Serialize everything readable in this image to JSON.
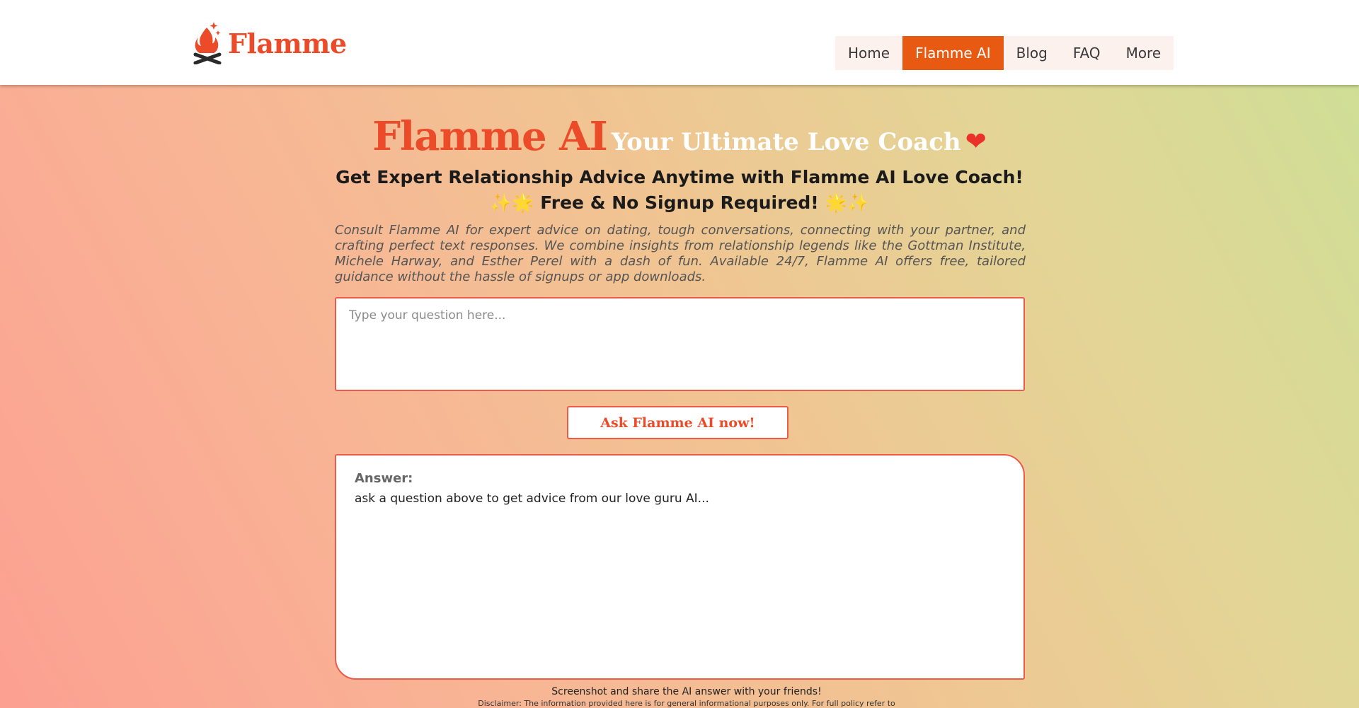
{
  "header": {
    "logo_text": "Flamme",
    "nav": [
      {
        "label": "Home",
        "active": false
      },
      {
        "label": "Flamme AI",
        "active": true
      },
      {
        "label": "Blog",
        "active": false
      },
      {
        "label": "FAQ",
        "active": false
      },
      {
        "label": "More",
        "active": false
      }
    ]
  },
  "hero": {
    "brand": "Flamme AI",
    "tagline": "Your Ultimate Love Coach",
    "heart_icon": "heart-on-fire-icon",
    "subtitle1": "Get Expert Relationship Advice Anytime with Flamme AI Love Coach!",
    "sparkles_left": "✨🌟",
    "subtitle2": "Free & No Signup Required!",
    "sparkles_right": "🌟✨",
    "description": "Consult Flamme AI for expert advice on dating, tough conversations, connecting with your partner, and crafting perfect text responses. We combine insights from relationship legends like the Gottman Institute, Michele Harway, and Esther Perel with a dash of fun. Available 24/7, Flamme AI offers free, tailored guidance without the hassle of signups or app downloads."
  },
  "question": {
    "placeholder": "Type your question here...",
    "value": ""
  },
  "ask_button": "Ask Flamme AI now!",
  "answer": {
    "label": "Answer:",
    "text": "ask a question above to get advice from our love guru AI..."
  },
  "footer": {
    "share": "Screenshot and share the AI answer with your friends!",
    "disclaimer": "Disclaimer: The information provided here is for general informational purposes only. For full policy refer to"
  },
  "colors": {
    "brand": "#ec4b2a",
    "nav_active": "#e85a12",
    "border": "#ec5a4a"
  }
}
